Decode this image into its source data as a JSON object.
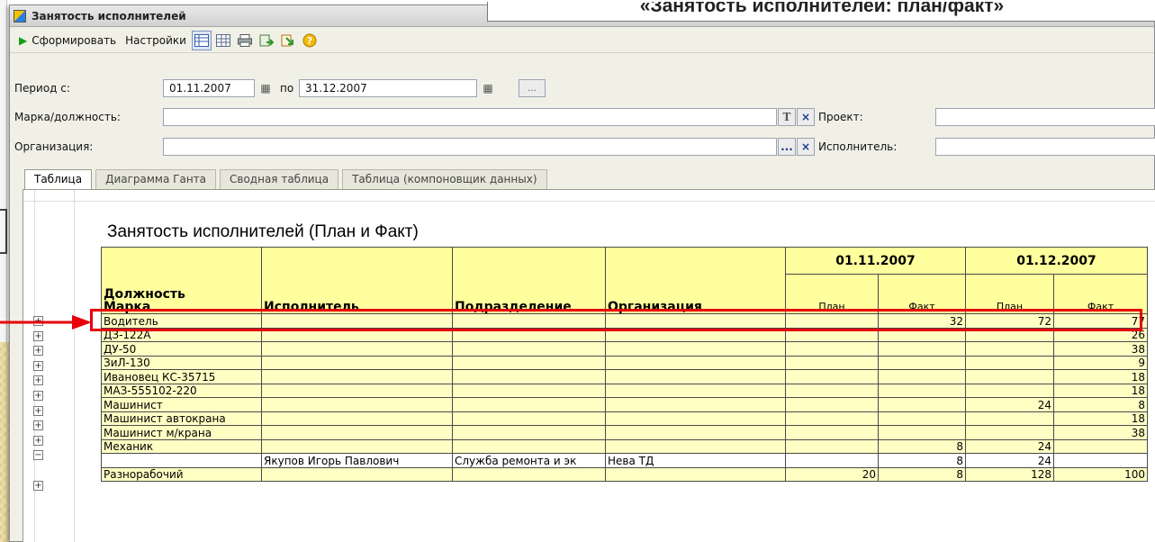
{
  "window": {
    "title": "Занятость исполнителей",
    "slide_title": "«Занятость исполнителей: план/факт»"
  },
  "toolbar": {
    "generate_label": "Сформировать",
    "settings_label": "Настройки"
  },
  "filters": {
    "period_from_label": "Период с:",
    "period_from_value": "01.11.2007",
    "period_to_label": "по",
    "period_to_value": "31.12.2007",
    "position_label": "Марка/должность:",
    "position_value": "",
    "project_label": "Проект:",
    "project_value": "",
    "organization_label": "Организация:",
    "organization_value": "",
    "executor_label": "Исполнитель:",
    "executor_value": "",
    "more_button": "...",
    "type_button": "T",
    "select_button": "...",
    "clear_button": "×"
  },
  "tabs": [
    {
      "label": "Таблица",
      "active": true
    },
    {
      "label": "Диаграмма Ганта",
      "active": false
    },
    {
      "label": "Сводная таблица",
      "active": false
    },
    {
      "label": "Таблица (компоновщик данных)",
      "active": false
    }
  ],
  "report": {
    "title": "Занятость исполнителей (План и Факт)",
    "headers": {
      "position_line1": "Должность",
      "position_line2": "Марка",
      "executor": "Исполнитель",
      "department": "Подразделение",
      "organization": "Организация",
      "date1": "01.11.2007",
      "date2": "01.12.2007",
      "plan": "План",
      "fact": "Факт"
    },
    "rows": [
      {
        "position": "Водитель",
        "executor": "",
        "department": "",
        "organization": "",
        "p1": "",
        "f1": "32",
        "p2": "72",
        "f2": "77",
        "tree": "+"
      },
      {
        "position": "ДЗ-122А",
        "executor": "",
        "department": "",
        "organization": "",
        "p1": "",
        "f1": "",
        "p2": "",
        "f2": "26",
        "tree": "+"
      },
      {
        "position": "ДУ-50",
        "executor": "",
        "department": "",
        "organization": "",
        "p1": "",
        "f1": "",
        "p2": "",
        "f2": "38",
        "tree": "+"
      },
      {
        "position": "ЗиЛ-130",
        "executor": "",
        "department": "",
        "organization": "",
        "p1": "",
        "f1": "",
        "p2": "",
        "f2": "9",
        "tree": "+"
      },
      {
        "position": "Ивановец КС-35715",
        "executor": "",
        "department": "",
        "organization": "",
        "p1": "",
        "f1": "",
        "p2": "",
        "f2": "18",
        "tree": "+"
      },
      {
        "position": "МАЗ-555102-220",
        "executor": "",
        "department": "",
        "organization": "",
        "p1": "",
        "f1": "",
        "p2": "",
        "f2": "18",
        "tree": "+"
      },
      {
        "position": "Машинист",
        "executor": "",
        "department": "",
        "organization": "",
        "p1": "",
        "f1": "",
        "p2": "24",
        "f2": "8",
        "tree": "+"
      },
      {
        "position": "Машинист автокрана",
        "executor": "",
        "department": "",
        "organization": "",
        "p1": "",
        "f1": "",
        "p2": "",
        "f2": "18",
        "tree": "+"
      },
      {
        "position": "Машинист м/крана",
        "executor": "",
        "department": "",
        "organization": "",
        "p1": "",
        "f1": "",
        "p2": "",
        "f2": "38",
        "tree": "+"
      },
      {
        "position": "Механик",
        "executor": "",
        "department": "",
        "organization": "",
        "p1": "",
        "f1": "8",
        "p2": "24",
        "f2": "",
        "tree": "−"
      },
      {
        "position": "",
        "executor": "Якупов Игорь Павлович",
        "department": "Служба ремонта и эк",
        "organization": "Нева ТД",
        "p1": "",
        "f1": "8",
        "p2": "24",
        "f2": "",
        "tree": "",
        "child": true
      },
      {
        "position": "Разнорабочий",
        "executor": "",
        "department": "",
        "organization": "",
        "p1": "20",
        "f1": "8",
        "p2": "128",
        "f2": "100",
        "tree": "+"
      }
    ]
  },
  "colors": {
    "header_fill": "#ffff9e",
    "row_fill": "#ffffc4",
    "highlight": "#e8000a",
    "generate_icon": "#12a012"
  }
}
